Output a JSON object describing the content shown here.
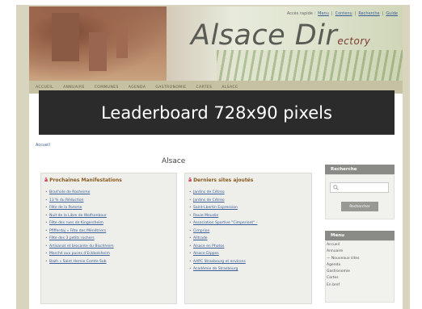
{
  "header": {
    "top_links": {
      "prefix": "Accès rapide :",
      "items": [
        "Menu",
        "Contenu",
        "Recherche",
        "Guide"
      ],
      "separator": "|"
    },
    "title_main": "Alsace Dir",
    "title_small": "ectory"
  },
  "nav": {
    "items": [
      "ACCUEIL",
      "ANNUAIRE",
      "COMMUNES",
      "AGENDA",
      "GASTRONOMIE",
      "CARTES",
      "ALSACE"
    ]
  },
  "leaderboard": {
    "text": "Leaderboard 728x90 pixels"
  },
  "breadcrumb": "Accueil",
  "section_title": "Alsace",
  "manifestations": {
    "icon": "rss-icon",
    "title": "Prochaines Manifestations",
    "items": [
      "Brad'oile de Rosheime",
      "13 % du Réduction",
      "Fête de la Pomme",
      "Nuit de la Libre de Wolfsenbour",
      "Fête des rues de Kingersheim",
      "Pfifferdaj « Fête des Ménétriers",
      "Fête des 3 petits rochers",
      "Artisanat et brocante du Bischheim",
      "Marché aux puces d'Eckbolsheim",
      "Bazh « Saint Hernie Comte Sob"
    ]
  },
  "derniers_sites": {
    "icon": "rss-icon",
    "title": "Derniers sites ajoutés",
    "items": [
      "Jardins de Cétreo",
      "Jardins de Cétreo",
      "Saint-Lbertin Expression",
      "Rauie Meuslie",
      "Association Sportive \"Cimperiant\" -",
      "Cimprion",
      "Alltrade",
      "Alsace en Photos",
      "Alsace Dippes",
      "AAPC Strasbourg et environs",
      "Académie de Strasbourg"
    ]
  },
  "search": {
    "title": "Recherche",
    "placeholder": "",
    "button_label": "Rechercher"
  },
  "menu": {
    "title": "Menu",
    "items": [
      "Accueil",
      "Annuaire",
      "— Nouveaux sites",
      "Agenda",
      "Gastronomie",
      "Cartes",
      "En bref"
    ]
  }
}
